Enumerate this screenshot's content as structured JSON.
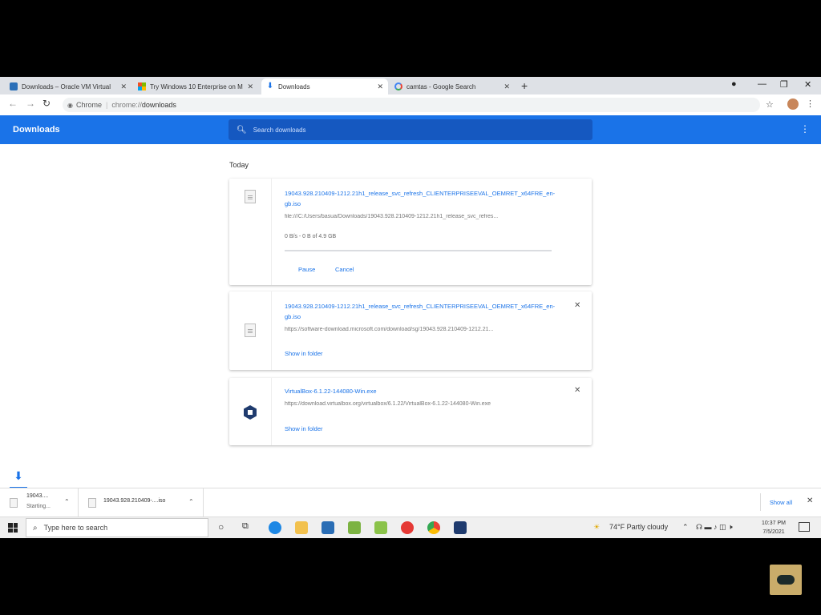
{
  "browser": {
    "tabs": [
      {
        "title": "Downloads – Oracle VM Virtual",
        "favicon": "virtualbox-icon",
        "active": false
      },
      {
        "title": "Try Windows 10 Enterprise on M",
        "favicon": "windows-icon",
        "active": false
      },
      {
        "title": "Downloads",
        "favicon": "download-icon",
        "active": true
      },
      {
        "title": "camtas - Google Search",
        "favicon": "google-icon",
        "active": false
      }
    ],
    "new_tab_label": "+",
    "omnibox": {
      "site_label": "Chrome",
      "url_prefix": "chrome://",
      "url_path": "downloads"
    }
  },
  "downloads_page": {
    "title": "Downloads",
    "search_placeholder": "Search downloads",
    "section_label": "Today",
    "items": [
      {
        "filename": "19043.928.210409-1212.21h1_release_svc_refresh_CLIENTERPRISEEVAL_OEMRET_x64FRE_en-gb.iso",
        "path": "file:///C:/Users/basua/Downloads/19043.928.210409-1212.21h1_release_svc_refres...",
        "status": "0 B/s - 0 B of 4.9 GB",
        "progress": 0,
        "actions": [
          "Pause",
          "Cancel"
        ],
        "icon": "file-icon"
      },
      {
        "filename": "19043.928.210409-1212.21h1_release_svc_refresh_CLIENTERPRISEEVAL_OEMRET_x64FRE_en-gb.iso",
        "path": "https://software-download.microsoft.com/download/sg/19043.928.210409-1212.21...",
        "action": "Show in folder",
        "icon": "file-icon"
      },
      {
        "filename": "VirtualBox-6.1.22-144080-Win.exe",
        "path": "https://download.virtualbox.org/virtualbox/6.1.22/VirtualBox-6.1.22-144080-Win.exe",
        "action": "Show in folder",
        "icon": "virtualbox-icon"
      }
    ]
  },
  "shelf": {
    "items": [
      {
        "name": "19043....",
        "status": "Starting..."
      },
      {
        "name": "19043.928.210409-....iso"
      }
    ],
    "show_all": "Show all"
  },
  "taskbar": {
    "search_placeholder": "Type here to search",
    "weather": "74°F Partly cloudy",
    "time": "10:37 PM",
    "date": "7/5/2021"
  },
  "colors": {
    "accent": "#1a73e8",
    "header": "#1a73e8"
  }
}
